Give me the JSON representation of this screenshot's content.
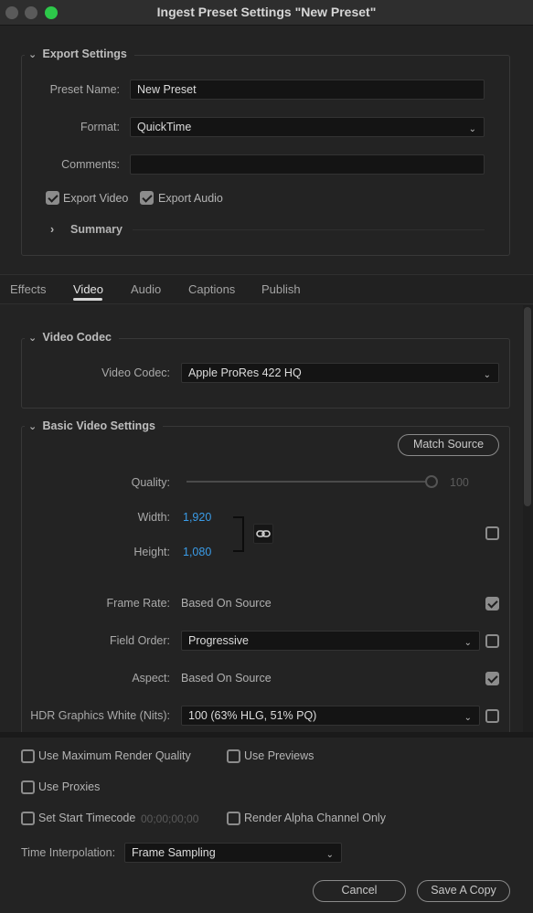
{
  "window": {
    "title": "Ingest Preset Settings \"New Preset\"",
    "traffic_lights": [
      {
        "name": "close",
        "color": "#5a5a5a"
      },
      {
        "name": "minimize",
        "color": "#5a5a5a"
      },
      {
        "name": "maximize",
        "color": "#2dc84a"
      }
    ]
  },
  "export_settings": {
    "header": "Export Settings",
    "preset_name_label": "Preset Name:",
    "preset_name_value": "New Preset",
    "format_label": "Format:",
    "format_value": "QuickTime",
    "comments_label": "Comments:",
    "comments_value": "",
    "export_video_label": "Export Video",
    "export_video_checked": true,
    "export_audio_label": "Export Audio",
    "export_audio_checked": true,
    "summary_label": "Summary"
  },
  "tabs": [
    {
      "label": "Effects",
      "active": false
    },
    {
      "label": "Video",
      "active": true
    },
    {
      "label": "Audio",
      "active": false
    },
    {
      "label": "Captions",
      "active": false
    },
    {
      "label": "Publish",
      "active": false
    }
  ],
  "video_codec": {
    "header": "Video Codec",
    "label": "Video Codec:",
    "value": "Apple ProRes 422 HQ"
  },
  "basic_video": {
    "header": "Basic Video Settings",
    "match_source": "Match Source",
    "quality_label": "Quality:",
    "quality_value": "100",
    "quality_fraction": 1.0,
    "width_label": "Width:",
    "width_value": "1,920",
    "height_label": "Height:",
    "height_value": "1,080",
    "dimensions_override_checked": false,
    "frame_rate_label": "Frame Rate:",
    "frame_rate_value": "Based On Source",
    "frame_rate_checked": true,
    "field_order_label": "Field Order:",
    "field_order_value": "Progressive",
    "field_order_checked": false,
    "aspect_label": "Aspect:",
    "aspect_value": "Based On Source",
    "aspect_checked": true,
    "hdr_label": "HDR Graphics White (Nits):",
    "hdr_value": "100 (63% HLG, 51% PQ)",
    "hdr_checked": false
  },
  "bottom": {
    "use_max_render_quality": {
      "label": "Use Maximum Render Quality",
      "checked": false
    },
    "use_previews": {
      "label": "Use Previews",
      "checked": false
    },
    "use_proxies": {
      "label": "Use Proxies",
      "checked": false
    },
    "set_start_timecode": {
      "label": "Set Start Timecode",
      "checked": false,
      "timecode": "00;00;00;00"
    },
    "render_alpha_only": {
      "label": "Render Alpha Channel Only",
      "checked": false
    },
    "time_interpolation_label": "Time Interpolation:",
    "time_interpolation_value": "Frame Sampling",
    "cancel": "Cancel",
    "save_copy": "Save A Copy"
  }
}
